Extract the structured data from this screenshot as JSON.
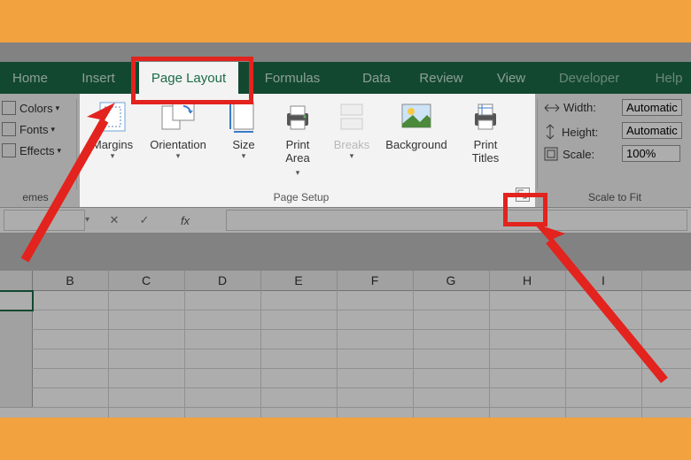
{
  "tabs": {
    "home": "Home",
    "insert": "Insert",
    "layout": "Page Layout",
    "formulas": "Formulas",
    "data": "Data",
    "review": "Review",
    "view": "View",
    "dev": "Developer",
    "help": "Help"
  },
  "themes": {
    "colors": "Colors",
    "fonts": "Fonts",
    "effects": "Effects",
    "group": "emes"
  },
  "pagesetup": {
    "margins": "Margins",
    "orientation": "Orientation",
    "size": "Size",
    "printarea": "Print\nArea",
    "breaks": "Breaks",
    "background": "Background",
    "titles": "Print\nTitles",
    "group": "Page Setup"
  },
  "scalefit": {
    "width_lbl": "Width:",
    "width_val": "Automatic",
    "height_lbl": "Height:",
    "height_val": "Automatic",
    "scale_lbl": "Scale:",
    "scale_val": "100%",
    "group": "Scale to Fit"
  },
  "fx": {
    "fx_label": "fx"
  },
  "cols": [
    "B",
    "C",
    "D",
    "E",
    "F",
    "G",
    "H",
    "I"
  ]
}
